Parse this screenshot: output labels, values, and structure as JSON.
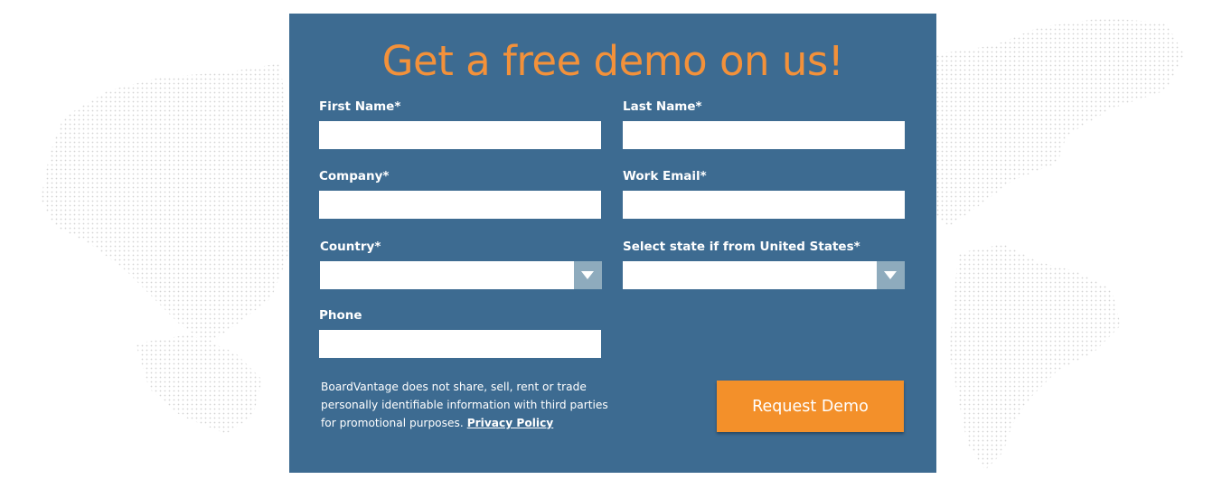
{
  "form": {
    "headline": "Get a free demo on us!",
    "fields": {
      "first_name": {
        "label": "First Name*",
        "value": ""
      },
      "last_name": {
        "label": "Last Name*",
        "value": ""
      },
      "company": {
        "label": "Company*",
        "value": ""
      },
      "work_email": {
        "label": "Work Email*",
        "value": ""
      },
      "country": {
        "label": "Country*",
        "value": ""
      },
      "state": {
        "label": "Select state if from United States*",
        "value": ""
      },
      "phone": {
        "label": "Phone",
        "value": ""
      }
    },
    "disclaimer": "BoardVantage does not share, sell, rent or trade personally identifiable information with third parties for promotional purposes.",
    "privacy_link": "Privacy Policy",
    "submit_label": "Request Demo"
  },
  "colors": {
    "panel_bg": "#3d6b91",
    "accent_orange": "#f3902a",
    "select_arrow_bg": "#8eabbd",
    "map_dots": "#d9d9d9"
  },
  "icons": {
    "dropdown": "chevron-down-icon"
  }
}
